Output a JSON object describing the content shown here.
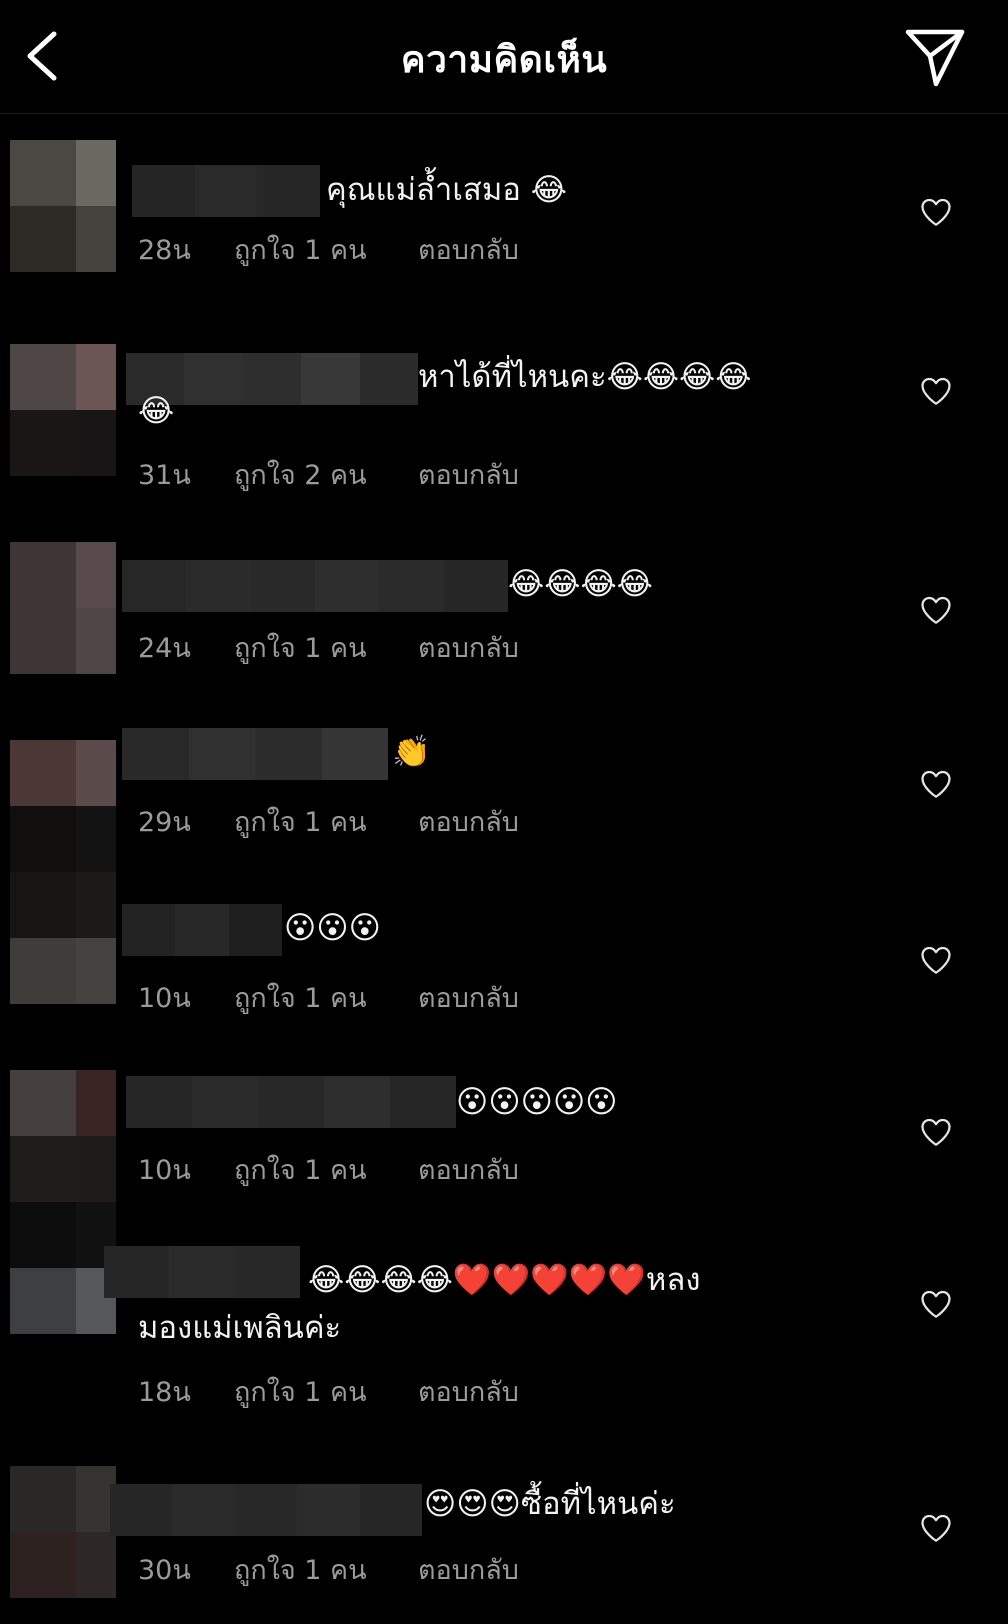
{
  "header": {
    "title": "ความคิดเห็น"
  },
  "comments": [
    {
      "text": "คุณแม่ล้ำเสมอ 😂",
      "time": "28น",
      "likes": "ถูกใจ 1 คน",
      "reply": "ตอบกลับ"
    },
    {
      "text": "หาได้ที่ไหนคะ😂😂😂😂",
      "text_line2": "😂",
      "time": "31น",
      "likes": "ถูกใจ 2 คน",
      "reply": "ตอบกลับ"
    },
    {
      "text": "😂😂😂😂",
      "time": "24น",
      "likes": "ถูกใจ 1 คน",
      "reply": "ตอบกลับ"
    },
    {
      "text": "👏",
      "time": "29น",
      "likes": "ถูกใจ 1 คน",
      "reply": "ตอบกลับ"
    },
    {
      "text": "😮😮😮",
      "time": "10น",
      "likes": "ถูกใจ 1 คน",
      "reply": "ตอบกลับ"
    },
    {
      "text": "😮😮😮😮😮",
      "time": "10น",
      "likes": "ถูกใจ 1 คน",
      "reply": "ตอบกลับ"
    },
    {
      "text": "😂😂😂😂❤️❤️❤️❤️❤️หลง",
      "text_line2": "มองแม่เพลินค่ะ",
      "time": "18น",
      "likes": "ถูกใจ 1 คน",
      "reply": "ตอบกลับ"
    },
    {
      "text": "😍😍😍ซื้อที่ไหนค่ะ",
      "time": "30น",
      "likes": "ถูกใจ 1 คน",
      "reply": "ตอบกลับ"
    }
  ],
  "icons": {
    "back": "chevron-left-icon",
    "share": "paper-plane-icon",
    "like": "heart-outline-icon"
  },
  "colors": {
    "background": "#000000",
    "meta_text": "#9b9b9b",
    "primary_text": "#ffffff"
  }
}
